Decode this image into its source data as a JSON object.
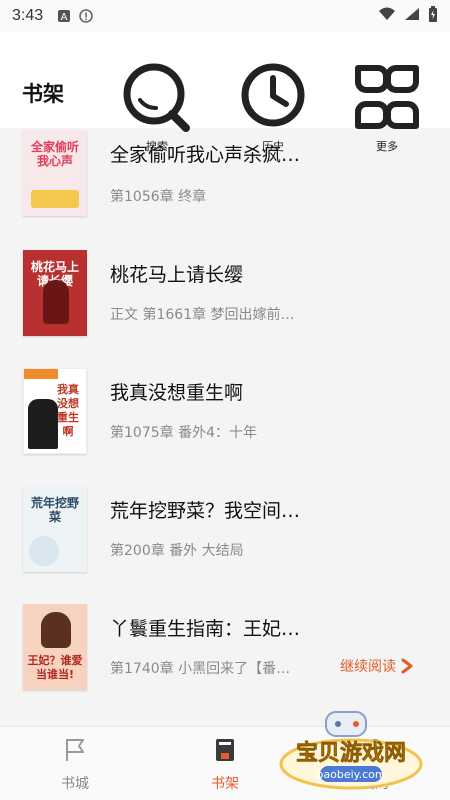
{
  "status": {
    "time": "3:43"
  },
  "header": {
    "title": "书架",
    "tools": [
      {
        "label": "搜索",
        "icon": "search-icon"
      },
      {
        "label": "历史",
        "icon": "history-icon"
      },
      {
        "label": "更多",
        "icon": "more-icon"
      }
    ]
  },
  "books": [
    {
      "title": "全家偷听我心声杀疯…",
      "subtitle": "第1056章 终章",
      "cover_text": "全家偷听我心声",
      "cover_color": "#f6e7e7"
    },
    {
      "title": "桃花马上请长缨",
      "subtitle": "正文 第1661章 梦回出嫁前…",
      "cover_text": "桃花马上请长缨",
      "cover_color": "#c63a3a"
    },
    {
      "title": "我真没想重生啊",
      "subtitle": "第1075章 番外4：十年",
      "cover_text": "我真没想重生啊",
      "cover_color": "#ffffff"
    },
    {
      "title": "荒年挖野菜？我空间…",
      "subtitle": "第200章 番外 大结局",
      "cover_text": "荒年挖野菜",
      "cover_color": "#eef3f6"
    },
    {
      "title": "丫鬟重生指南：王妃…",
      "subtitle": "第1740章 小黑回来了【番…",
      "cover_text": "王妃？谁爱当谁当!",
      "cover_color": "#f7d6c4",
      "action": "继续阅读"
    }
  ],
  "tabs": [
    {
      "label": "书城",
      "icon": "flag-icon",
      "active": false
    },
    {
      "label": "书架",
      "icon": "book-icon",
      "active": true
    },
    {
      "label": "我的",
      "icon": "user-icon",
      "active": false
    }
  ],
  "watermark": {
    "text": "宝贝游戏网",
    "url": "baobeiy.com"
  },
  "colors": {
    "accent": "#e35b2a",
    "active_tab": "#e35b2a",
    "inactive_tab": "#888888"
  }
}
